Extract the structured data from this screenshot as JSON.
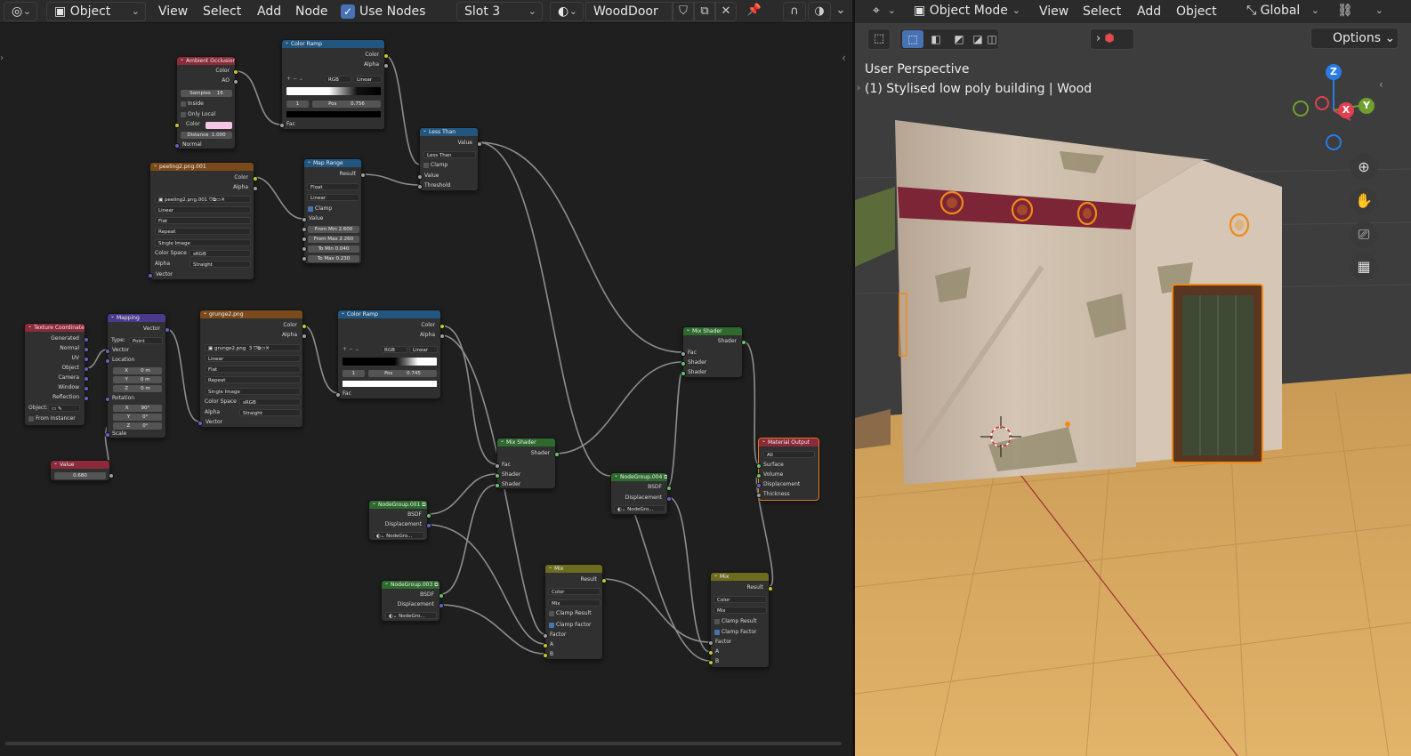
{
  "node_editor": {
    "header": {
      "editor_type_icon": "node-editor-icon",
      "mode": "Object",
      "menu": [
        "View",
        "Select",
        "Add",
        "Node"
      ],
      "use_nodes_label": "Use Nodes",
      "use_nodes_checked": true,
      "slot": "Slot 3",
      "material_name": "WoodDoor"
    },
    "nodes": {
      "ao": {
        "title": "Ambient Occlusion",
        "out_color": "Color",
        "out_ao": "AO",
        "samples_label": "Samples",
        "samples": "16",
        "inside": "Inside",
        "only_local": "Only Local",
        "in_color": "Color",
        "distance_label": "Distance",
        "distance": "1.000",
        "normal": "Normal"
      },
      "cramp1": {
        "title": "Color Ramp",
        "out_color": "Color",
        "out_alpha": "Alpha",
        "mode": "RGB",
        "interp": "Linear",
        "index": "1",
        "pos_label": "Pos",
        "pos": "0.756",
        "fac": "Fac"
      },
      "lessthan": {
        "title": "Less Than",
        "out_value": "Value",
        "op": "Less Than",
        "clamp": "Clamp",
        "in_value": "Value",
        "in_threshold": "Threshold"
      },
      "peeling": {
        "title": "peeling2.png.001",
        "out_color": "Color",
        "out_alpha": "Alpha",
        "image": "peeling2.png.001",
        "interp": "Linear",
        "proj": "Flat",
        "ext": "Repeat",
        "src": "Single Image",
        "cs_label": "Color Space",
        "cs": "sRGB",
        "alpha_label": "Alpha",
        "alpha": "Straight",
        "vector": "Vector"
      },
      "maprange": {
        "title": "Map Range",
        "out_result": "Result",
        "type": "Float",
        "interp": "Linear",
        "clamp": "Clamp",
        "in_value": "Value",
        "from_min_label": "From Min",
        "from_min": "2.600",
        "from_max_label": "From Max",
        "from_max": "2.260",
        "to_min_label": "To Min",
        "to_min": "0.040",
        "to_max_label": "To Max",
        "to_max": "0.230"
      },
      "texcoord": {
        "title": "Texture Coordinate",
        "outs": [
          "Generated",
          "Normal",
          "UV",
          "Object",
          "Camera",
          "Window",
          "Reflection"
        ],
        "object_label": "Object:",
        "from_instancer": "From Instancer"
      },
      "mapping": {
        "title": "Mapping",
        "out_vector": "Vector",
        "type_label": "Type:",
        "type": "Point",
        "vector": "Vector",
        "location": "Location",
        "loc": [
          "X",
          "0 m",
          "Y",
          "0 m",
          "Z",
          "0 m"
        ],
        "rotation": "Rotation",
        "rot": [
          "X",
          "90°",
          "Y",
          "0°",
          "Z",
          "0°"
        ],
        "scale": "Scale"
      },
      "grunge": {
        "title": "grunge2.png",
        "out_color": "Color",
        "out_alpha": "Alpha",
        "image": "grunge2.png",
        "users": "3",
        "interp": "Linear",
        "proj": "Flat",
        "ext": "Repeat",
        "src": "Single Image",
        "cs_label": "Color Space",
        "cs": "sRGB",
        "alpha_label": "Alpha",
        "alpha": "Straight",
        "vector": "Vector"
      },
      "cramp2": {
        "title": "Color Ramp",
        "out_color": "Color",
        "out_alpha": "Alpha",
        "mode": "RGB",
        "interp": "Linear",
        "index": "1",
        "pos_label": "Pos",
        "pos": "0.745",
        "fac": "Fac"
      },
      "value": {
        "title": "Value",
        "value": "0.680"
      },
      "mixshader1": {
        "title": "Mix Shader",
        "out_shader": "Shader",
        "fac": "Fac",
        "shader1": "Shader",
        "shader2": "Shader"
      },
      "mixshader2": {
        "title": "Mix Shader",
        "out_shader": "Shader",
        "fac": "Fac",
        "shader1": "Shader",
        "shader2": "Shader"
      },
      "ng001": {
        "title": "NodeGroup.001",
        "bsdf": "BSDF",
        "disp": "Displacement",
        "group": "NodeGro..."
      },
      "ng003": {
        "title": "NodeGroup.003",
        "bsdf": "BSDF",
        "disp": "Displacement",
        "group": "NodeGro..."
      },
      "ng004": {
        "title": "NodeGroup.004",
        "bsdf": "BSDF",
        "disp": "Displacement",
        "group": "NodeGro..."
      },
      "mix1": {
        "title": "Mix",
        "out_result": "Result",
        "dtype": "Color",
        "blend": "Mix",
        "clamp_result": "Clamp Result",
        "clamp_factor": "Clamp Factor",
        "factor": "Factor",
        "a": "A",
        "b": "B"
      },
      "mix2": {
        "title": "Mix",
        "out_result": "Result",
        "dtype": "Color",
        "blend": "Mix",
        "clamp_result": "Clamp Result",
        "clamp_factor": "Clamp Factor",
        "factor": "Factor",
        "a": "A",
        "b": "B"
      },
      "matout": {
        "title": "Material Output",
        "target": "All",
        "surface": "Surface",
        "volume": "Volume",
        "displacement": "Displacement",
        "thickness": "Thickness"
      }
    }
  },
  "viewport": {
    "header": {
      "mode": "Object Mode",
      "menu": [
        "View",
        "Select",
        "Add",
        "Object"
      ],
      "transform": "Global",
      "options": "Options"
    },
    "overlay_title": "User Perspective",
    "overlay_object": "(1) Stylised low poly building | Wood",
    "gizmo": {
      "z": "Z",
      "y": "Y",
      "x": "X"
    },
    "colors": {
      "x_axis": "#e04050",
      "y_axis": "#6fa02e",
      "z_axis": "#2a7be4",
      "selection": "#f08a18"
    }
  }
}
